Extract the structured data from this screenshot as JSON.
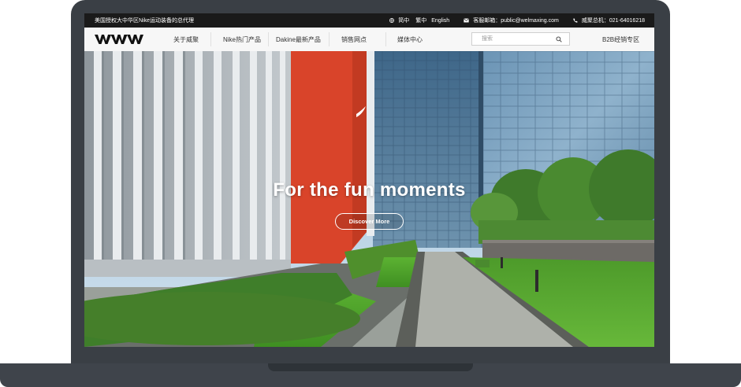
{
  "topbar": {
    "slogan": "美国授权大中华区Nike运动装备的总代理",
    "lang_simplified": "简中",
    "lang_traditional": "繁中",
    "lang_english": "English",
    "email_text": "客服邮箱：public@welmaxing.com",
    "phone_text": "威聚总机：021-64016218"
  },
  "nav": {
    "items": [
      {
        "label": "关于威聚"
      },
      {
        "label": "Nike热门产品"
      },
      {
        "label": "Dakine最新产品"
      },
      {
        "label": "销售网点"
      },
      {
        "label": "媒体中心"
      }
    ],
    "b2b_label": "B2B经销专区"
  },
  "search": {
    "placeholder": "搜索"
  },
  "hero": {
    "title": "For the fun moments",
    "button_label": "Discover More"
  },
  "colors": {
    "topbar_bg": "#1a1a1a",
    "nav_bg": "#f7f7f7",
    "laptop_body": "#3a3f45",
    "building_orange": "#d9442a",
    "lawn_green": "#4fa32c"
  }
}
